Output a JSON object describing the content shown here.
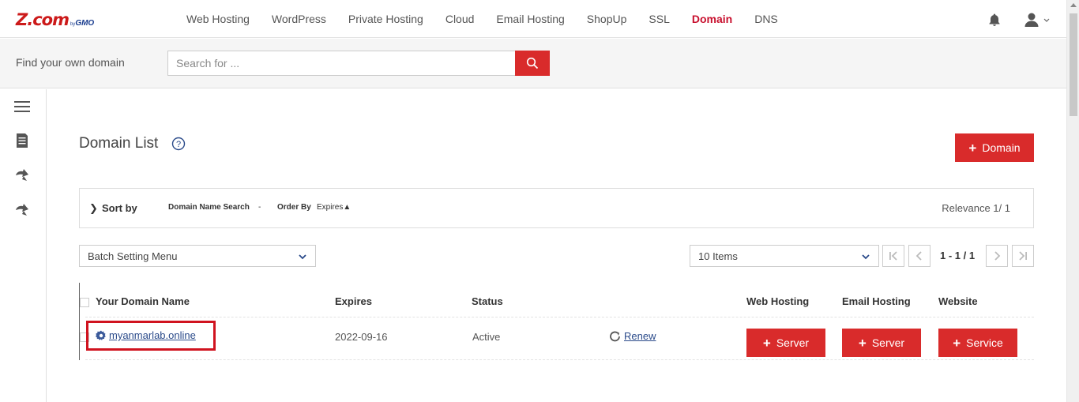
{
  "brand": {
    "logo_main": "Z.com",
    "logo_by": "by",
    "logo_gmo": "GMO"
  },
  "nav": {
    "items": [
      {
        "label": "Web Hosting"
      },
      {
        "label": "WordPress"
      },
      {
        "label": "Private Hosting"
      },
      {
        "label": "Cloud"
      },
      {
        "label": "Email Hosting"
      },
      {
        "label": "ShopUp"
      },
      {
        "label": "SSL"
      },
      {
        "label": "Domain",
        "active": true
      },
      {
        "label": "DNS"
      }
    ],
    "icons": [
      "bell-icon",
      "user-icon",
      "chevron-down-icon"
    ]
  },
  "search": {
    "label": "Find your own domain",
    "placeholder": "Search for ...",
    "value": ""
  },
  "sidebar": {
    "icons": [
      "menu-icon",
      "document-icon",
      "redirect-arrow-icon",
      "redirect-arrow-icon"
    ]
  },
  "page": {
    "title": "Domain List",
    "add_button": "Domain"
  },
  "sort": {
    "label": "Sort by",
    "domain_name_search": "Domain Name Search",
    "dash": "-",
    "order_by": "Order By",
    "expires": "Expires▲",
    "relevance": "Relevance 1/ 1"
  },
  "controls": {
    "batch_menu": "Batch Setting Menu",
    "items_per_page": "10 Items",
    "page_range": "1 - 1 / 1"
  },
  "table": {
    "headers": {
      "domain": "Your Domain Name",
      "expires": "Expires",
      "status": "Status",
      "web_hosting": "Web Hosting",
      "email_hosting": "Email Hosting",
      "website": "Website"
    },
    "rows": [
      {
        "domain": "myanmarlab.online",
        "expires": "2022-09-16",
        "status": "Active",
        "renew": "Renew",
        "web_hosting_btn": "Server",
        "email_hosting_btn": "Server",
        "website_btn": "Service"
      }
    ]
  },
  "colors": {
    "accent": "#d92b2b",
    "nav_active": "#c8102e",
    "link": "#2a4a8a",
    "highlight_border": "#d0131f"
  }
}
